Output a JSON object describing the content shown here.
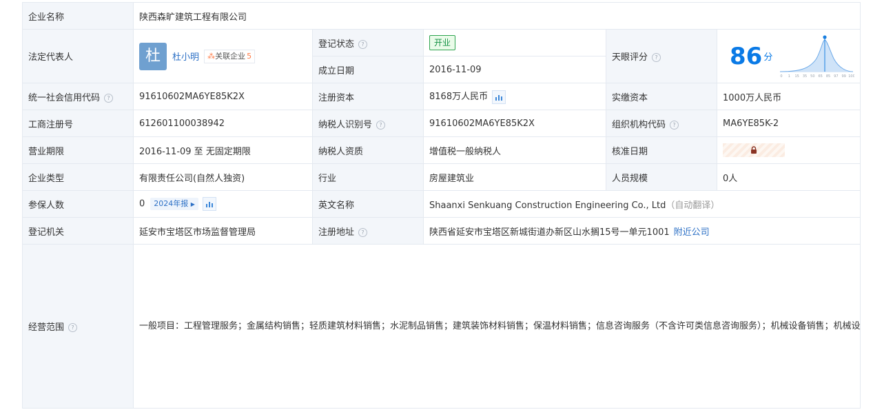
{
  "company_name": {
    "label": "企业名称",
    "value": "陕西森旷建筑工程有限公司"
  },
  "legal_rep": {
    "label": "法定代表人",
    "avatar_char": "杜",
    "name": "杜小明",
    "related_label": "关联企业",
    "related_count": "5"
  },
  "reg_status": {
    "label": "登记状态",
    "value": "开业"
  },
  "found_date": {
    "label": "成立日期",
    "value": "2016-11-09"
  },
  "tianyan_score": {
    "label": "天眼评分",
    "score": "86",
    "unit": "分",
    "axis_ticks": [
      "0",
      "1",
      "15",
      "35",
      "50",
      "65",
      "85",
      "97",
      "99",
      "100"
    ]
  },
  "credit_code": {
    "label": "统一社会信用代码",
    "value": "91610602MA6YE85K2X"
  },
  "reg_capital": {
    "label": "注册资本",
    "value": "8168万人民币"
  },
  "paid_capital": {
    "label": "实缴资本",
    "value": "1000万人民币"
  },
  "biz_reg_no": {
    "label": "工商注册号",
    "value": "612601100038942"
  },
  "taxpayer_id": {
    "label": "纳税人识别号",
    "value": "91610602MA6YE85K2X"
  },
  "org_code": {
    "label": "组织机构代码",
    "value": "MA6YE85K-2"
  },
  "biz_term": {
    "label": "营业期限",
    "value": "2016-11-09 至 无固定期限"
  },
  "taxpayer_qual": {
    "label": "纳税人资质",
    "value": "增值税一般纳税人"
  },
  "approve_date": {
    "label": "核准日期"
  },
  "company_type": {
    "label": "企业类型",
    "value": "有限责任公司(自然人独资)"
  },
  "industry": {
    "label": "行业",
    "value": "房屋建筑业"
  },
  "staff_size": {
    "label": "人员规模",
    "value": "0人"
  },
  "insured": {
    "label": "参保人数",
    "value": "0",
    "report": "2024年报"
  },
  "english_name": {
    "label": "英文名称",
    "value": "Shaanxi Senkuang Construction Engineering Co., Ltd",
    "note": "（自动翻译）"
  },
  "reg_authority": {
    "label": "登记机关",
    "value": "延安市宝塔区市场监督管理局"
  },
  "reg_address": {
    "label": "注册地址",
    "value": "陕西省延安市宝塔区新城街道办新区山水搁15号一单元1001",
    "link": "附近公司"
  },
  "business_scope": {
    "label": "经营范围",
    "value": "一般项目：工程管理服务；金属结构销售；轻质建筑材料销售；水泥制品销售；建筑装饰材料销售；保温材料销售；信息咨询服务（不含许可类信息咨询服务）；机械设备销售；机械设备租赁；市政设施管理；对外承包工程；机械电气设备销售；消防器材销售；消防技术服务；劳务服务（不含劳务派遣）；土石方工程施工；体育场地设施工程施工；金属门窗工程施工；园林绿化工程施工；安全技术防范系统设计施工服务；五金产品零售；建筑物清洁服务；房屋拆迁服务；物业管理；金属制品销售；建筑工程机械与设备租赁；住宅水电安装维护服务；建筑防水卷材产品销售；办公用品销售；技术服务、技术开发、技术咨询、技术交流、技术转让、技术推广；仪器仪表销售；普通机械设备安装服务；建筑材料销售；广告设计、代理；广告制作；广告发布；地质勘探和地震专用仪器销售；地质勘查专用设备销售；地质勘查技术服务；深海石油钻探设备销售；石油钻采专用设备销售；石油天然气技术服务；石油制品销售（不含危险化学品）(除依法须经批准的项目外，凭营业执照依法自主开展经营活动)。许可项目：文物保护工程施工；地质灾害治理工程施工；建设工程监理；建设工程设计；建设工程勘察；建筑劳务分包；住宅室内装饰装修；城市建筑垃圾处置（清运）；施工专业作业；道路货物运输（网络货运）；道路货物运输（不含危险货物）；输电、供电、受电电力设施的安装、维修和试验；建筑物拆除作业（爆破作业除外）；建筑智能化系统设计；金属与非金属矿产资源地质勘探；陆地石油和天然气开采；非煤矿山矿产资源开采；深海海底区域资源勘探开发(依法须经批准的项目，经相关部门批准后方可开展经营活动，具体经营项目以审批结果为准)。"
  }
}
